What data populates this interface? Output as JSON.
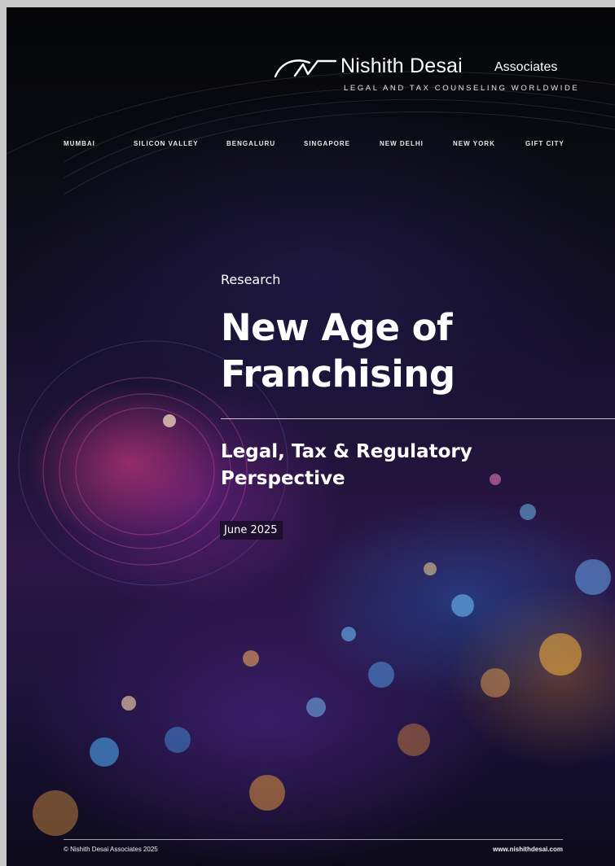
{
  "brand": {
    "name": "Nishith Desai",
    "suffix": "Associates",
    "tagline": "LEGAL AND TAX COUNSELING WORLDWIDE"
  },
  "cities": [
    "MUMBAI",
    "SILICON VALLEY",
    "BENGALURU",
    "SINGAPORE",
    "NEW DELHI",
    "NEW YORK",
    "GIFT CITY"
  ],
  "cover": {
    "category": "Research",
    "title_line1": "New Age of",
    "title_line2": "Franchising",
    "subtitle_line1": "Legal, Tax & Regulatory",
    "subtitle_line2": "Perspective",
    "date": "June 2025"
  },
  "footer": {
    "copyright": "© Nishith Desai Associates 2025",
    "website": "www.nishithdesai.com"
  },
  "colors": {
    "background_dark": "#050608",
    "accent_magenta": "#dc3c78",
    "accent_blue": "#2878e6",
    "accent_amber": "#e69628",
    "text": "#ffffff"
  },
  "icons": [
    "logo-mark-icon"
  ]
}
